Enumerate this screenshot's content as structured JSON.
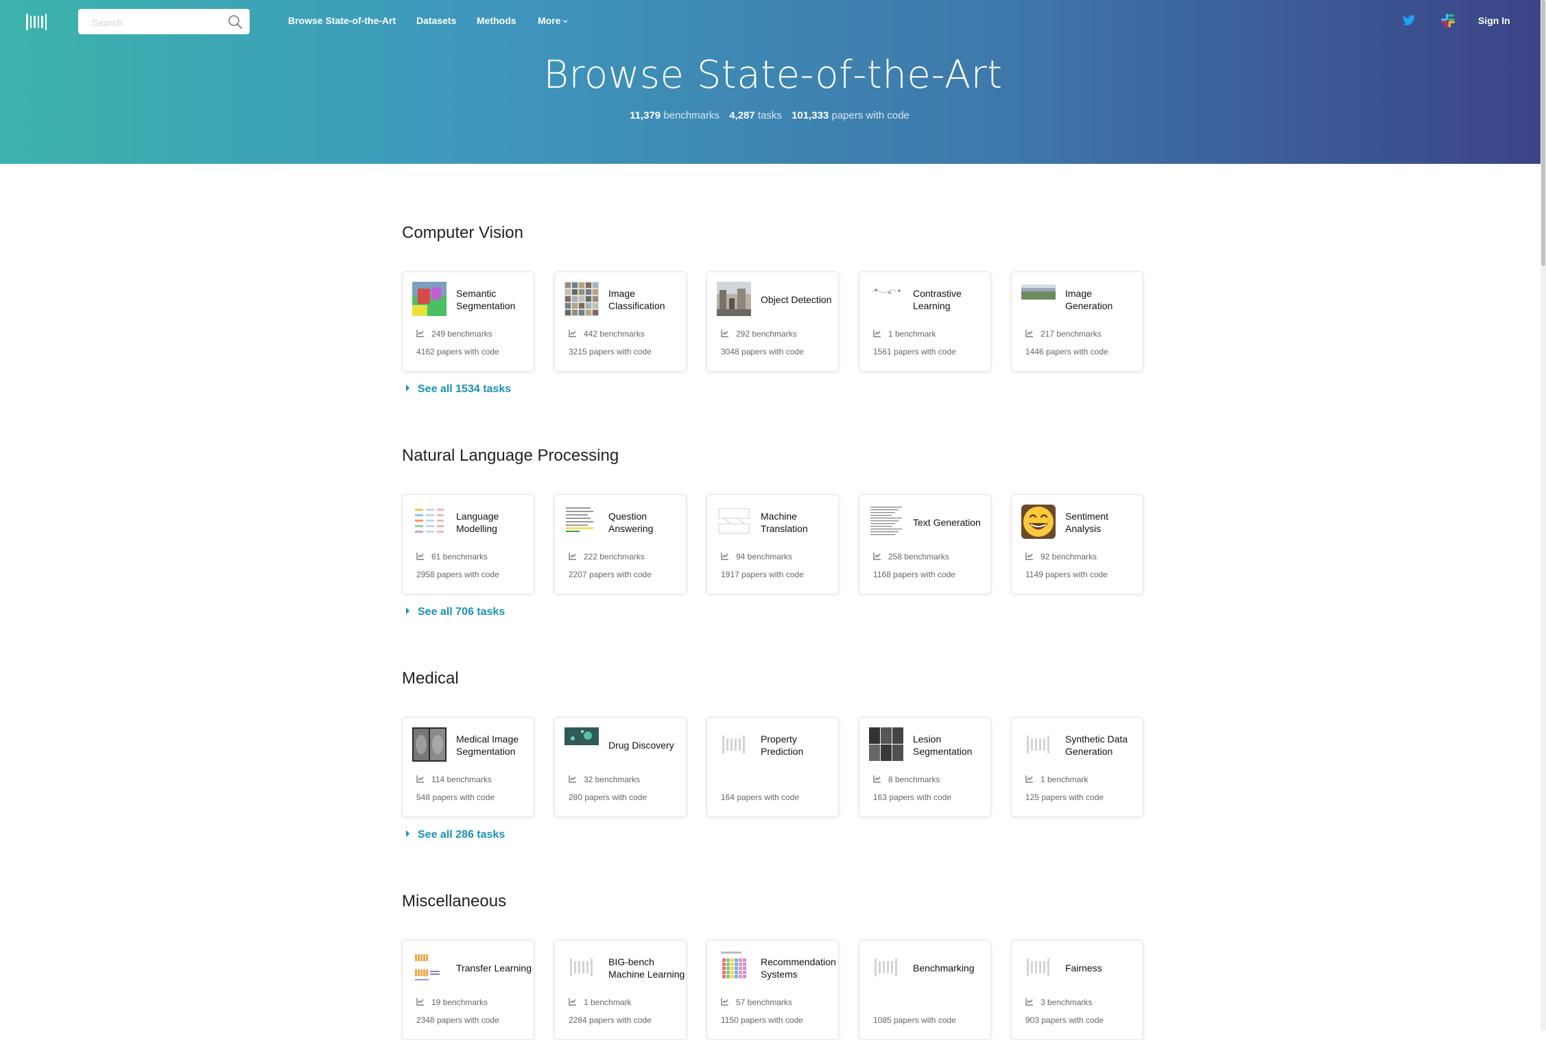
{
  "header": {
    "search_placeholder": "Search",
    "nav": [
      "Browse State-of-the-Art",
      "Datasets",
      "Methods",
      "More"
    ],
    "sign_in": "Sign In",
    "title": "Browse State-of-the-Art",
    "stats": [
      {
        "value": "11,379",
        "label": "benchmarks"
      },
      {
        "value": "4,287",
        "label": "tasks"
      },
      {
        "value": "101,333",
        "label": "papers with code"
      }
    ]
  },
  "sections": [
    {
      "title": "Computer Vision",
      "see_all": "See all 1534 tasks",
      "cards": [
        {
          "name": "Semantic Segmentation",
          "benchmarks": "249 benchmarks",
          "papers": "4162 papers with code",
          "thumb": "segmentation-image"
        },
        {
          "name": "Image Classification",
          "benchmarks": "442 benchmarks",
          "papers": "3215 papers with code",
          "thumb": "image-grid"
        },
        {
          "name": "Object Detection",
          "benchmarks": "292 benchmarks",
          "papers": "3048 papers with code",
          "thumb": "street-photo"
        },
        {
          "name": "Contrastive Learning",
          "benchmarks": "1 benchmark",
          "papers": "1561 papers with code",
          "thumb": "contrastive-diagram"
        },
        {
          "name": "Image Generation",
          "benchmarks": "217 benchmarks",
          "papers": "1446 papers with code",
          "thumb": "generated-strip"
        }
      ]
    },
    {
      "title": "Natural Language Processing",
      "see_all": "See all 706 tasks",
      "cards": [
        {
          "name": "Language Modelling",
          "benchmarks": "61 benchmarks",
          "papers": "2958 papers with code",
          "thumb": "lm-diagram"
        },
        {
          "name": "Question Answering",
          "benchmarks": "222 benchmarks",
          "papers": "2207 papers with code",
          "thumb": "qa-text"
        },
        {
          "name": "Machine Translation",
          "benchmarks": "94 benchmarks",
          "papers": "1917 papers with code",
          "thumb": "mt-diagram"
        },
        {
          "name": "Text Generation",
          "benchmarks": "258 benchmarks",
          "papers": "1168 papers with code",
          "thumb": "text-lines"
        },
        {
          "name": "Sentiment Analysis",
          "benchmarks": "92 benchmarks",
          "papers": "1149 papers with code",
          "thumb": "smiley-emoji"
        }
      ]
    },
    {
      "title": "Medical",
      "see_all": "See all 286 tasks",
      "cards": [
        {
          "name": "Medical Image Segmentation",
          "benchmarks": "114 benchmarks",
          "papers": "548 papers with code",
          "thumb": "mri-scan"
        },
        {
          "name": "Drug Discovery",
          "benchmarks": "32 benchmarks",
          "papers": "280 papers with code",
          "thumb": "molecule-image"
        },
        {
          "name": "Property Prediction",
          "benchmarks": "",
          "papers": "164 papers with code",
          "thumb": "placeholder-logo"
        },
        {
          "name": "Lesion Segmentation",
          "benchmarks": "8 benchmarks",
          "papers": "163 papers with code",
          "thumb": "lesion-grid"
        },
        {
          "name": "Synthetic Data Generation",
          "benchmarks": "1 benchmark",
          "papers": "125 papers with code",
          "thumb": "placeholder-logo"
        }
      ]
    },
    {
      "title": "Miscellaneous",
      "see_all": "",
      "cards": [
        {
          "name": "Transfer Learning",
          "benchmarks": "19 benchmarks",
          "papers": "2348 papers with code",
          "thumb": "transfer-diagram"
        },
        {
          "name": "BIG-bench Machine Learning",
          "benchmarks": "1 benchmark",
          "papers": "2284 papers with code",
          "thumb": "placeholder-logo"
        },
        {
          "name": "Recommendation Systems",
          "benchmarks": "57 benchmarks",
          "papers": "1150 papers with code",
          "thumb": "recsys-matrix"
        },
        {
          "name": "Benchmarking",
          "benchmarks": "",
          "papers": "1085 papers with code",
          "thumb": "placeholder-logo"
        },
        {
          "name": "Fairness",
          "benchmarks": "3 benchmarks",
          "papers": "903 papers with code",
          "thumb": "placeholder-logo"
        }
      ]
    }
  ],
  "colors": {
    "accent": "#1a92b4",
    "twitter": "#1da1f2"
  }
}
